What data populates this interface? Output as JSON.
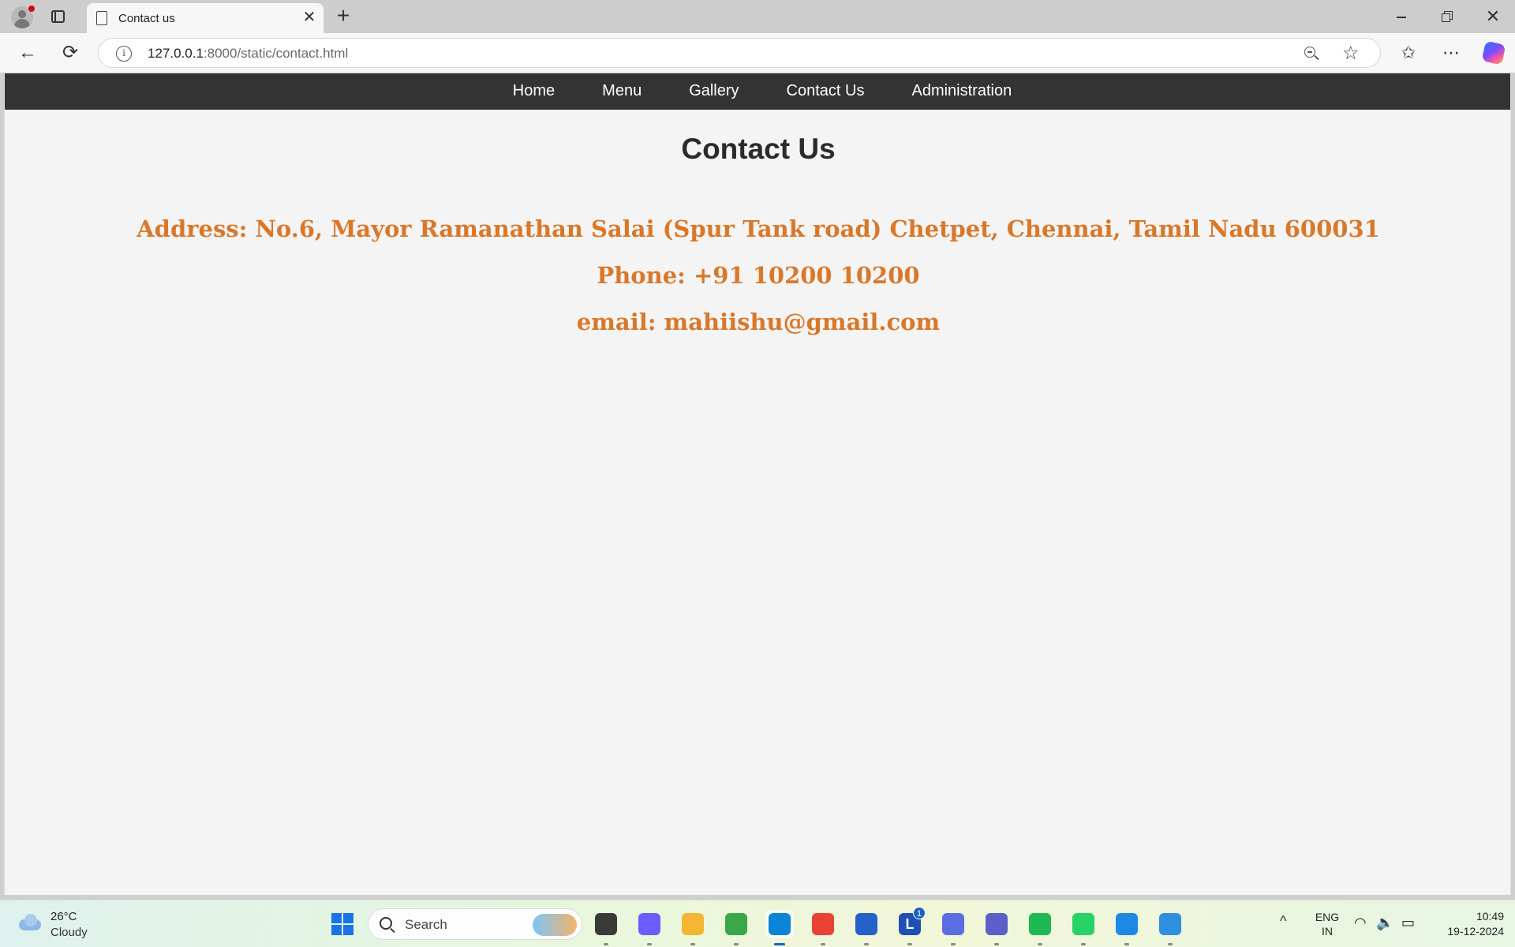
{
  "browser": {
    "tab_title": "Contact us",
    "tab_close": "✕",
    "new_tab": "+",
    "url_host": "127.0.0.1",
    "url_path": ":8000/static/contact.html",
    "back": "←",
    "reload": "⟳",
    "favorite": "☆",
    "favorites_bar": "✩",
    "more": "⋯",
    "close_window": "✕"
  },
  "site": {
    "nav": [
      "Home",
      "Menu",
      "Gallery",
      "Contact Us",
      "Administration"
    ],
    "title": "Contact Us",
    "address": "Address: No.6, Mayor Ramanathan Salai (Spur Tank road) Chetpet, Chennai, Tamil Nadu 600031",
    "phone": "Phone: +91 10200 10200",
    "email": "email: mahiishu@gmail.com",
    "colors": {
      "nav_bg": "#333333",
      "accent": "#d9782a",
      "page_bg": "#f4f4f4"
    }
  },
  "taskbar": {
    "weather_temp": "26°C",
    "weather_cond": "Cloudy",
    "search_label": "Search",
    "apps": [
      {
        "name": "task-view",
        "color": "#3a3a3a"
      },
      {
        "name": "copilot",
        "color": "#6a5cff"
      },
      {
        "name": "file-explorer",
        "color": "#f2b632"
      },
      {
        "name": "app-green-ring",
        "color": "#3aa84a"
      },
      {
        "name": "edge",
        "color": "#0c84d6"
      },
      {
        "name": "chrome",
        "color": "#e94235"
      },
      {
        "name": "microsoft-store",
        "color": "#2461c8"
      },
      {
        "name": "app-l",
        "color": "#1f4fb3",
        "letter": "L",
        "badge": "1"
      },
      {
        "name": "app-triangle",
        "color": "#5b6ee1"
      },
      {
        "name": "teams",
        "color": "#5b5fc7"
      },
      {
        "name": "spotify",
        "color": "#1db954"
      },
      {
        "name": "whatsapp",
        "color": "#25d366"
      },
      {
        "name": "vscode",
        "color": "#1e88e5"
      },
      {
        "name": "photos",
        "color": "#2e8fe0"
      }
    ],
    "lang_top": "ENG",
    "lang_bottom": "IN",
    "tray_chevron": "^",
    "wifi": "◠",
    "volume": "🔈",
    "battery": "▭",
    "time": "10:49",
    "date": "19-12-2024"
  }
}
